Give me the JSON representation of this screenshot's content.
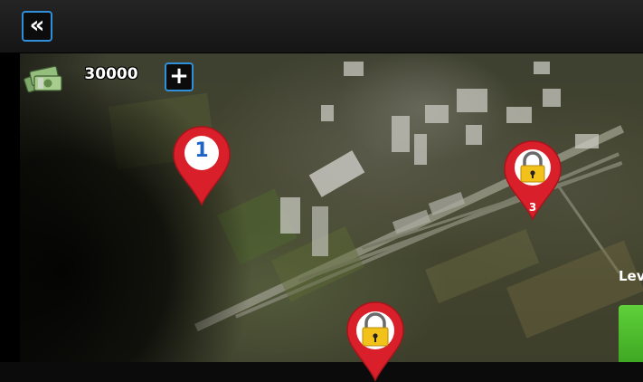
{
  "header": {
    "back_icon": "double-chevron-left-icon",
    "back_glyph": "«"
  },
  "wallet": {
    "icon": "money-stack-icon",
    "amount": "30000",
    "add_glyph": "+"
  },
  "map": {
    "pins": [
      {
        "id": "level-1",
        "label": "1",
        "locked": false,
        "color": "#d9202a"
      },
      {
        "id": "level-3",
        "label": "3",
        "locked": true,
        "color": "#d9202a"
      },
      {
        "id": "level-next",
        "label": "",
        "locked": true,
        "color": "#d9202a"
      }
    ]
  },
  "level_panel": {
    "label": "Lev"
  },
  "colors": {
    "accent": "#2f8fd8",
    "pin_red": "#d9202a",
    "lock_gold": "#f2c21b",
    "button_green": "#4cbb2a"
  }
}
